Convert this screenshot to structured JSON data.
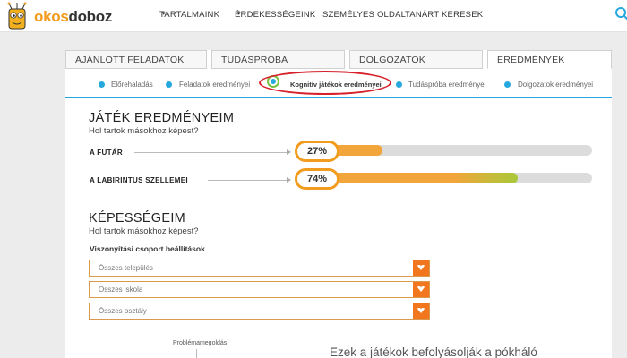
{
  "app": {
    "brand_part1": "okos",
    "brand_part2": "doboz",
    "colors": {
      "accent": "#f29c1f",
      "link_blue": "#26a8df",
      "highlight_red": "#d6202a",
      "bar_orange": "#f2a53a",
      "bar_green": "#a9c93a"
    }
  },
  "nav": {
    "items": [
      {
        "label": "TARTALMAINK",
        "has_caret": true
      },
      {
        "label": "ÉRDEKESSÉGEINK",
        "has_caret": true
      },
      {
        "label": "SZEMÉLYES OLDAL",
        "has_caret": false
      },
      {
        "label": "TANÁRT KERESEK",
        "has_caret": false
      }
    ],
    "caret_glyph": "▾",
    "search_icon": "search-icon"
  },
  "tabs": [
    {
      "label": "AJÁNLOTT FELADATOK",
      "active": false
    },
    {
      "label": "TUDÁSPRÓBA",
      "active": false
    },
    {
      "label": "DOLGOZATOK",
      "active": false
    },
    {
      "label": "EREDMÉNYEK",
      "active": true
    }
  ],
  "subtabs": [
    {
      "label": "Előrehaladás",
      "active": false
    },
    {
      "label": "Feladatok eredményei",
      "active": false
    },
    {
      "label": "Kognitív játékok eredményei",
      "active": true
    },
    {
      "label": "Tudáspróba eredményei",
      "active": false
    },
    {
      "label": "Dolgozatok eredményei",
      "active": false
    }
  ],
  "games": {
    "title": "JÁTÉK EREDMÉNYEIM",
    "subtitle": "Hol tartok másokhoz képest?",
    "rows": [
      {
        "label": "A FUTÁR",
        "percent_label": "27%",
        "percent": 27
      },
      {
        "label": "A LABIRINTUS SZELLEMEI",
        "percent_label": "74%",
        "percent": 74
      }
    ]
  },
  "skills": {
    "title": "KÉPESSÉGEIM",
    "subtitle": "Hol tartok másokhoz képest?",
    "group_label": "Viszonyítási csoport beállítások",
    "selects": [
      {
        "value": "Összes település"
      },
      {
        "value": "Összes iskola"
      },
      {
        "value": "Összes osztály"
      }
    ]
  },
  "radar": {
    "axis_label": "Problémamegoldás"
  },
  "bottom_text": "Ezek a játékok befolyásolják a pókháló"
}
